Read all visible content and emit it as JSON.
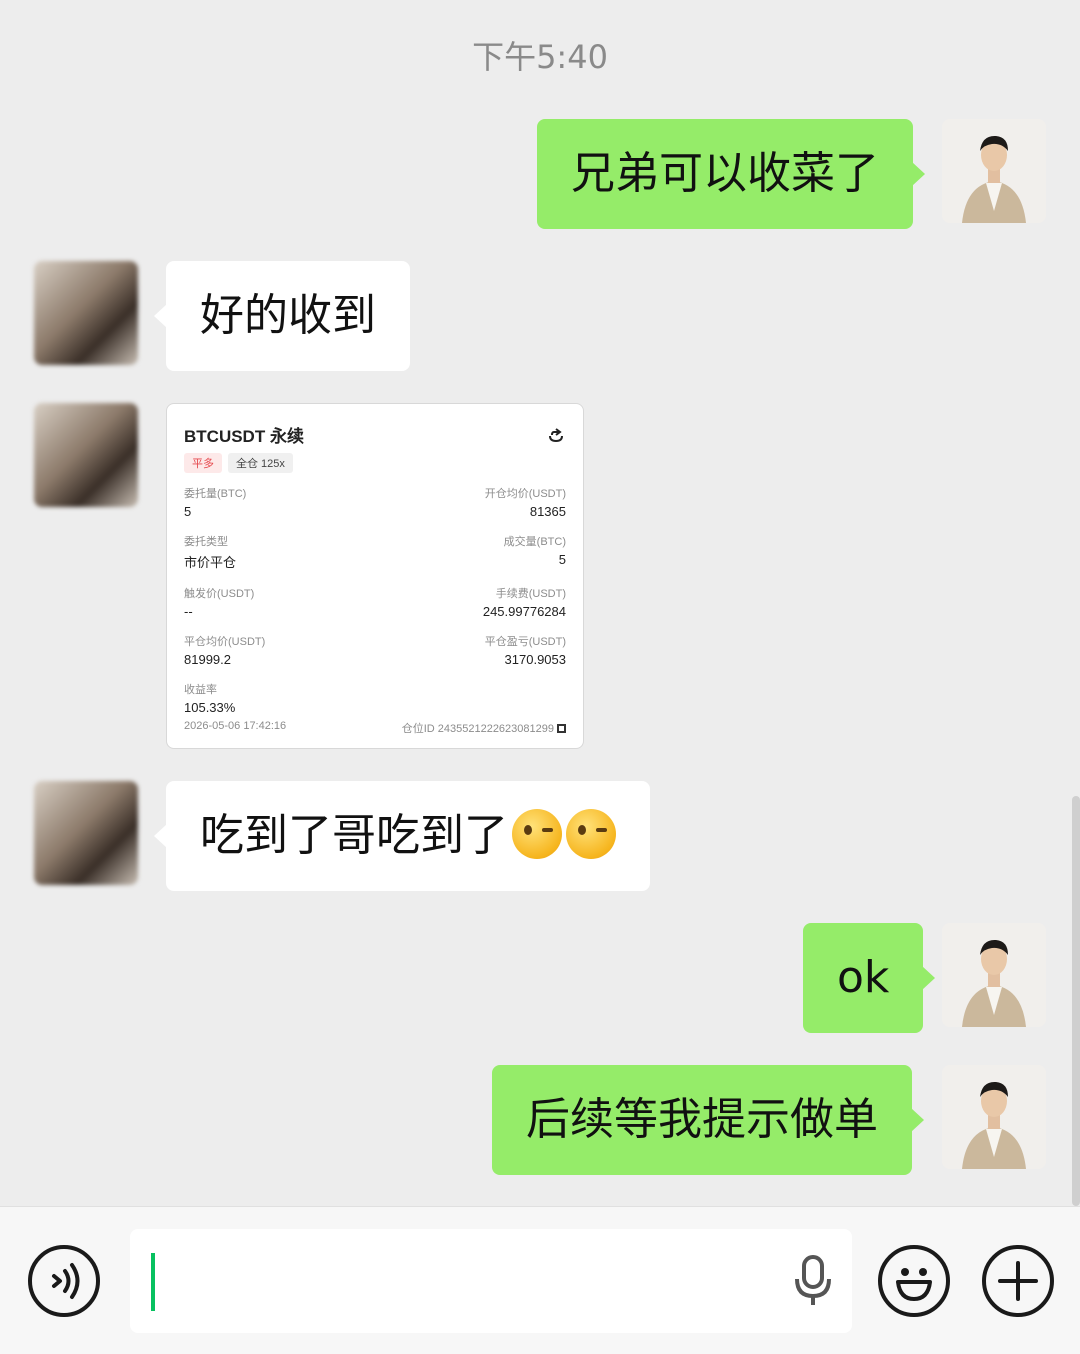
{
  "header": {
    "timestamp": "下午5:40"
  },
  "messages": [
    {
      "side": "me",
      "text": "兄弟可以收菜了"
    },
    {
      "side": "other",
      "text": "好的收到"
    },
    {
      "side": "other",
      "type": "card"
    },
    {
      "side": "other",
      "text": "吃到了哥吃到了",
      "emoji": [
        "wink-emoji",
        "wink-emoji"
      ]
    },
    {
      "side": "me",
      "text": "ok"
    },
    {
      "side": "me",
      "text": "后续等我提示做单"
    }
  ],
  "card": {
    "title": "BTCUSDT 永续",
    "tag_side": "平多",
    "tag_margin": "全仓 125x",
    "fields": {
      "order_qty_label": "委托量(BTC)",
      "order_qty": "5",
      "open_price_label": "开仓均价(USDT)",
      "open_price": "81365",
      "order_type_label": "委托类型",
      "order_type": "市价平仓",
      "filled_qty_label": "成交量(BTC)",
      "filled_qty": "5",
      "trigger_label": "触发价(USDT)",
      "trigger": "--",
      "fee_label": "手续费(USDT)",
      "fee": "245.99776284",
      "close_price_label": "平仓均价(USDT)",
      "close_price": "81999.2",
      "pnl_label": "平仓盈亏(USDT)",
      "pnl": "3170.9053",
      "roe_label": "收益率",
      "roe": "105.33%"
    },
    "datetime": "2026-05-06 17:42:16",
    "position_id": "仓位ID 2435521222623081299"
  },
  "input": {
    "value": ""
  },
  "icons": {
    "voice": "voice-toggle-icon",
    "mic": "microphone-icon",
    "emoji": "emoji-icon",
    "more": "plus-icon",
    "share": "share-icon",
    "copy": "copy-icon"
  },
  "colors": {
    "my_bubble": "#95ec69",
    "other_bubble": "#ffffff",
    "background": "#ededed",
    "cursor": "#07c160"
  }
}
